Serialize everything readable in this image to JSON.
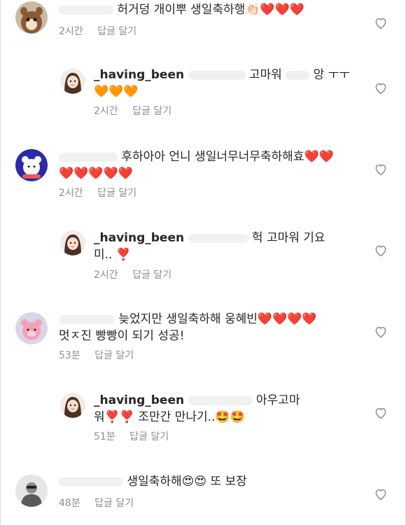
{
  "comments": [
    {
      "level": "top",
      "avatar": "chipmunk-avatar",
      "user": "",
      "text": [
        "허거덩 개이뿌 생일축하행👏🏻❤️❤️❤️"
      ],
      "time": "2시간",
      "reply": "답글 달기"
    },
    {
      "level": "reply",
      "avatar": "girl-avatar",
      "user": "_having_been",
      "text": [
        "고마워",
        "앙 ㅜㅜ",
        "🧡🧡🧡"
      ],
      "time": "2시간",
      "reply": "답글 달기"
    },
    {
      "level": "top",
      "avatar": "bear-avatar",
      "user": "",
      "text": [
        "후하아아 언니 생일너무너무축하해효❤️❤️",
        "❤️❤️❤️❤️❤️"
      ],
      "time": "2시간",
      "reply": "답글 달기"
    },
    {
      "level": "reply",
      "avatar": "girl-avatar",
      "user": "_having_been",
      "text": [
        "헉 고마워 기요",
        "미.. ❣️"
      ],
      "time": "2시간",
      "reply": "답글 달기"
    },
    {
      "level": "top",
      "avatar": "pink-bear-avatar",
      "user": "",
      "text": [
        "늦었지만 생일축하해 웅혜빈❤️❤️❤️❤️",
        "멋ㅈ진 빵빵이 되기 성공!"
      ],
      "time": "53분",
      "reply": "답글 달기"
    },
    {
      "level": "reply",
      "avatar": "girl-avatar",
      "user": "_having_been",
      "text": [
        "아우고마",
        "워❣️❣️ 조만간 만나기..🤩🤩"
      ],
      "time": "51분",
      "reply": "답글 달기"
    },
    {
      "level": "top",
      "avatar": "person-avatar",
      "user": "",
      "text": [
        "생일축하해😍😍 또 보장"
      ],
      "time": "48분",
      "reply": "답글 달기"
    }
  ]
}
